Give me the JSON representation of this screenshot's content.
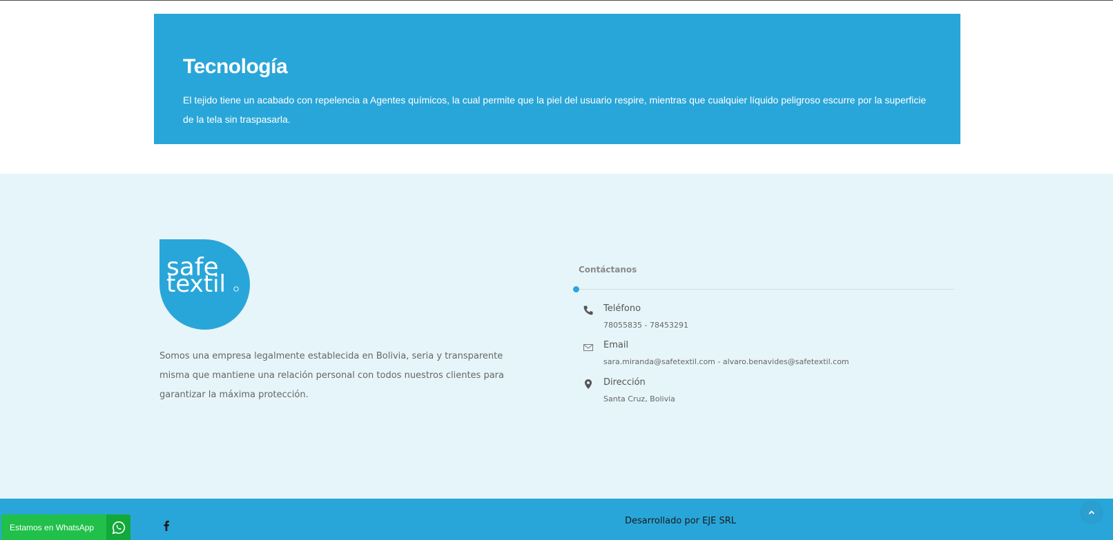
{
  "tech": {
    "title": "Tecnología",
    "body": "El tejido tiene un acabado con repelencia a Agentes químicos, la cual permite que la piel del usuario respire, mientras que cualquier líquido peligroso escurre por la superficie de la tela sin traspasarla."
  },
  "footer": {
    "logo_text_line1": "safe",
    "logo_text_line2": "textil",
    "about": "Somos una empresa legalmente establecida en Bolivia, seria y transparente misma que mantiene una relación personal con todos nuestros clientes para garantizar la máxima protección.",
    "contact_title": "Contáctanos",
    "phone_label": "Teléfono",
    "phone_value": "78055835 - 78453291",
    "email_label": "Email",
    "email_value": "sara.miranda@safetextil.com - alvaro.benavides@safetextil.com",
    "address_label": "Dirección",
    "address_value": "Santa Cruz, Bolivia"
  },
  "bottom": {
    "credit": "Desarrollado por EJE SRL"
  },
  "whatsapp": {
    "label": "Estamos en WhatsApp"
  },
  "colors": {
    "brand_blue": "#29a6d9",
    "footer_bg": "#e6f5f9",
    "whatsapp_green": "#20c04a"
  },
  "icons": {
    "phone": "phone-icon",
    "email": "mail-icon",
    "address": "map-pin-icon",
    "facebook": "facebook-icon",
    "scroll_top": "chevron-up-icon",
    "whatsapp": "whatsapp-icon"
  }
}
